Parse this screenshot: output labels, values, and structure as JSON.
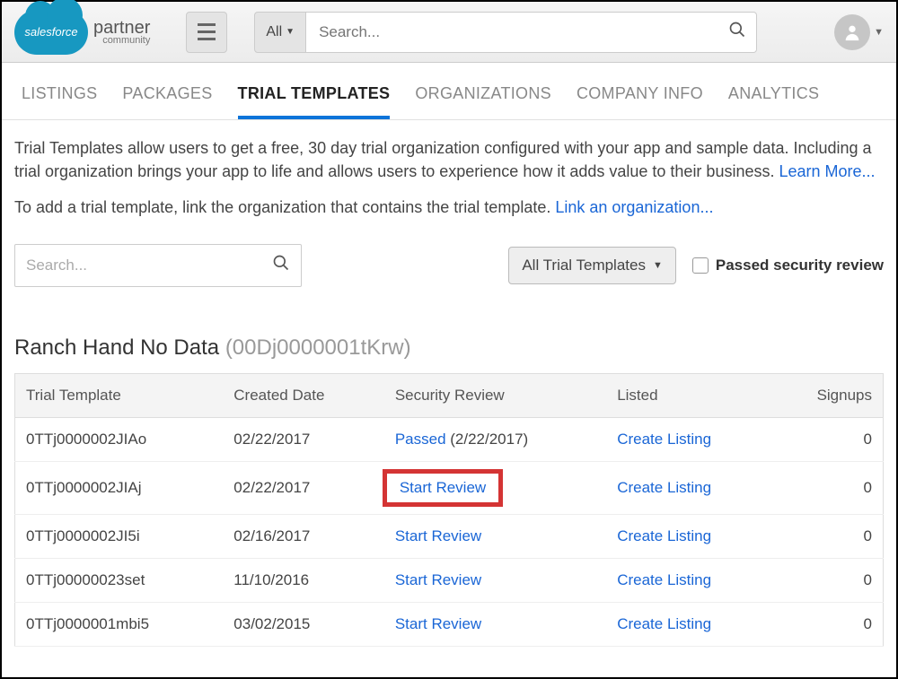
{
  "header": {
    "brand_cloud": "salesforce",
    "brand_text": "partner",
    "brand_sub": "community",
    "search_scope": "All",
    "search_placeholder": "Search..."
  },
  "tabs": [
    {
      "label": "LISTINGS",
      "active": false
    },
    {
      "label": "PACKAGES",
      "active": false
    },
    {
      "label": "TRIAL TEMPLATES",
      "active": true
    },
    {
      "label": "ORGANIZATIONS",
      "active": false
    },
    {
      "label": "COMPANY INFO",
      "active": false
    },
    {
      "label": "ANALYTICS",
      "active": false
    }
  ],
  "intro": {
    "p1a": "Trial Templates allow users to get a free, 30 day trial organization configured with your app and sample data. Including a trial organization brings your app to life and allows users to experience how it adds value to their business. ",
    "learn_more": "Learn More...",
    "p2a": "To add a trial template, link the organization that contains the trial template. ",
    "link_org": "Link an organization..."
  },
  "filters": {
    "search_placeholder": "Search...",
    "dropdown": "All Trial Templates",
    "checkbox_label": "Passed security review"
  },
  "section": {
    "title": "Ranch Hand No Data",
    "id": "(00Dj0000001tKrw)"
  },
  "table": {
    "headers": [
      "Trial Template",
      "Created Date",
      "Security Review",
      "Listed",
      "Signups"
    ],
    "rows": [
      {
        "tt": "0TTj0000002JIAo",
        "date": "02/22/2017",
        "review_link": "Passed",
        "review_extra": " (2/22/2017)",
        "listed": "Create Listing",
        "signups": "0",
        "hl": false
      },
      {
        "tt": "0TTj0000002JIAj",
        "date": "02/22/2017",
        "review_link": "Start Review",
        "review_extra": "",
        "listed": "Create Listing",
        "signups": "0",
        "hl": true
      },
      {
        "tt": "0TTj0000002JI5i",
        "date": "02/16/2017",
        "review_link": "Start Review",
        "review_extra": "",
        "listed": "Create Listing",
        "signups": "0",
        "hl": false
      },
      {
        "tt": "0TTj00000023set",
        "date": "11/10/2016",
        "review_link": "Start Review",
        "review_extra": "",
        "listed": "Create Listing",
        "signups": "0",
        "hl": false
      },
      {
        "tt": "0TTj0000001mbi5",
        "date": "03/02/2015",
        "review_link": "Start Review",
        "review_extra": "",
        "listed": "Create Listing",
        "signups": "0",
        "hl": false
      }
    ]
  }
}
